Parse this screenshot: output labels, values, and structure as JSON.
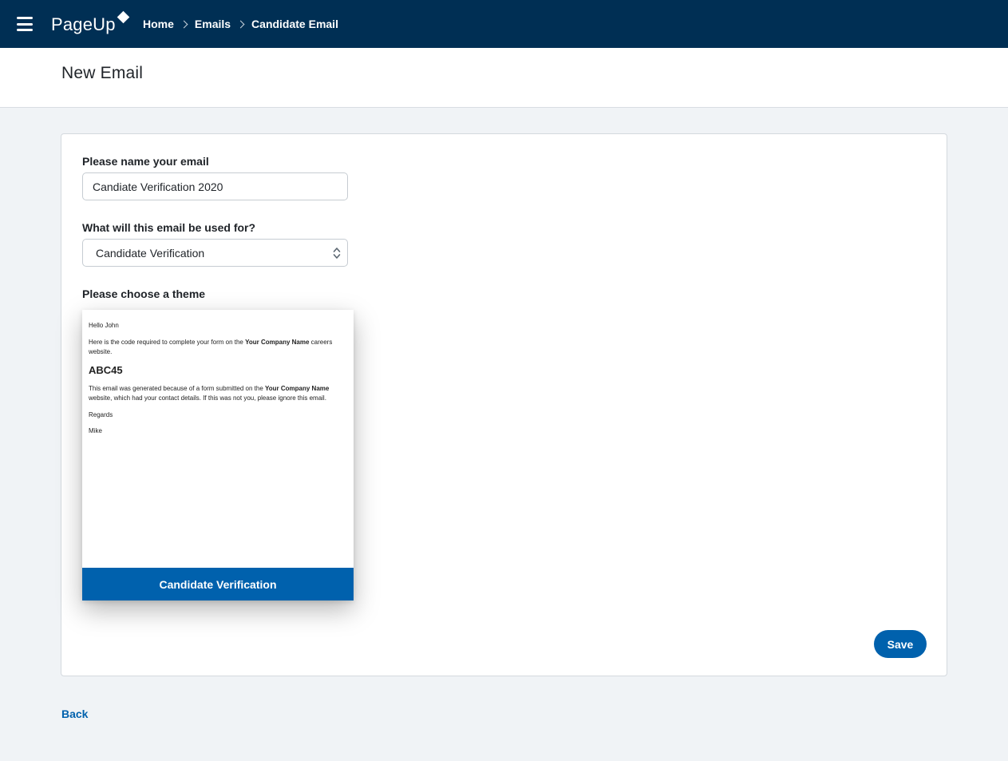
{
  "brand": {
    "name": "PageUp"
  },
  "breadcrumb": [
    "Home",
    "Emails",
    "Candidate Email"
  ],
  "page": {
    "title": "New Email"
  },
  "form": {
    "name_label": "Please name your email",
    "name_value": "Candiate Verification 2020",
    "usage_label": "What will this email be used for?",
    "usage_value": "Candidate Verification",
    "theme_label": "Please choose a theme"
  },
  "theme": {
    "greeting": "Hello John",
    "line1_pre": "Here is the code required to complete your form on the ",
    "company": "Your Company Name",
    "line1_post": " careers website.",
    "code": "ABC45",
    "line2_pre": "This email was generated because of a form submitted on the ",
    "line2_post": " website, which had your contact details. If this was not you, please ignore this email.",
    "regards": "Regards",
    "signature": "Mike",
    "name": "Candidate Verification"
  },
  "actions": {
    "save_label": "Save",
    "back_label": "Back"
  },
  "colors": {
    "topbar": "#002f54",
    "accent": "#0061ad",
    "background": "#f0f3f6"
  }
}
